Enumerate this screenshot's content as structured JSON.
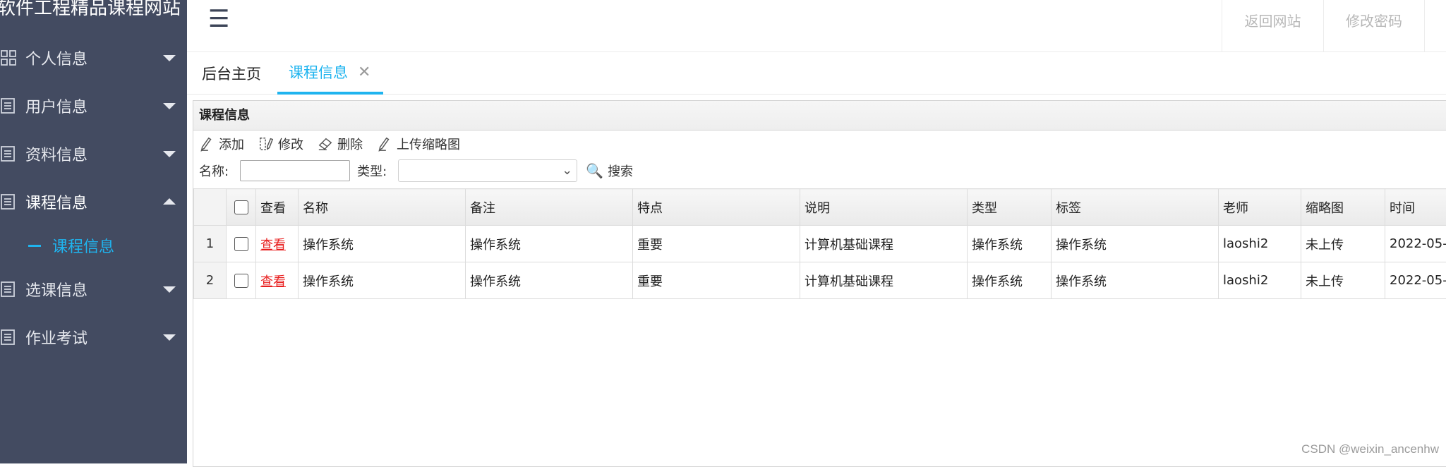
{
  "sidebar": {
    "site_title": "软件工程精品课程网站",
    "menu": [
      {
        "label": "个人信息",
        "icon": "grid-icon"
      },
      {
        "label": "用户信息",
        "icon": "list-icon"
      },
      {
        "label": "资料信息",
        "icon": "list-icon"
      },
      {
        "label": "课程信息",
        "icon": "list-icon",
        "open": true,
        "children": [
          "课程信息"
        ]
      },
      {
        "label": "选课信息",
        "icon": "list-icon"
      },
      {
        "label": "作业考试",
        "icon": "list-icon"
      }
    ]
  },
  "header": {
    "menu_icon": "☰",
    "links": {
      "home": "返回网站",
      "password": "修改密码"
    }
  },
  "tabs": {
    "home": "后台主页",
    "active": "课程信息",
    "close": "✕"
  },
  "panel": {
    "title": "课程信息",
    "toolbar": {
      "add": "添加",
      "edit": "修改",
      "delete": "删除",
      "upload": "上传缩略图"
    },
    "search": {
      "name_label": "名称:",
      "type_label": "类型:",
      "name_value": "",
      "type_value": "",
      "button": "搜索"
    },
    "columns": [
      "查看",
      "名称",
      "备注",
      "特点",
      "说明",
      "类型",
      "标签",
      "老师",
      "缩略图",
      "时间"
    ],
    "rows": [
      {
        "num": "1",
        "view": "查看",
        "name": "操作系统",
        "remark": "操作系统",
        "feature": "重要",
        "desc": "计算机基础课程",
        "type": "操作系统",
        "tag": "操作系统",
        "teacher": "laoshi2",
        "thumb": "未上传",
        "time": "2022-05-"
      },
      {
        "num": "2",
        "view": "查看",
        "name": "操作系统",
        "remark": "操作系统",
        "feature": "重要",
        "desc": "计算机基础课程",
        "type": "操作系统",
        "tag": "操作系统",
        "teacher": "laoshi2",
        "thumb": "未上传",
        "time": "2022-05-"
      }
    ]
  },
  "watermark": "CSDN @weixin_ancenhw",
  "colors": {
    "sidebar_bg": "#434b61",
    "accent": "#1fb4ef",
    "link_red": "#e81e1e"
  }
}
